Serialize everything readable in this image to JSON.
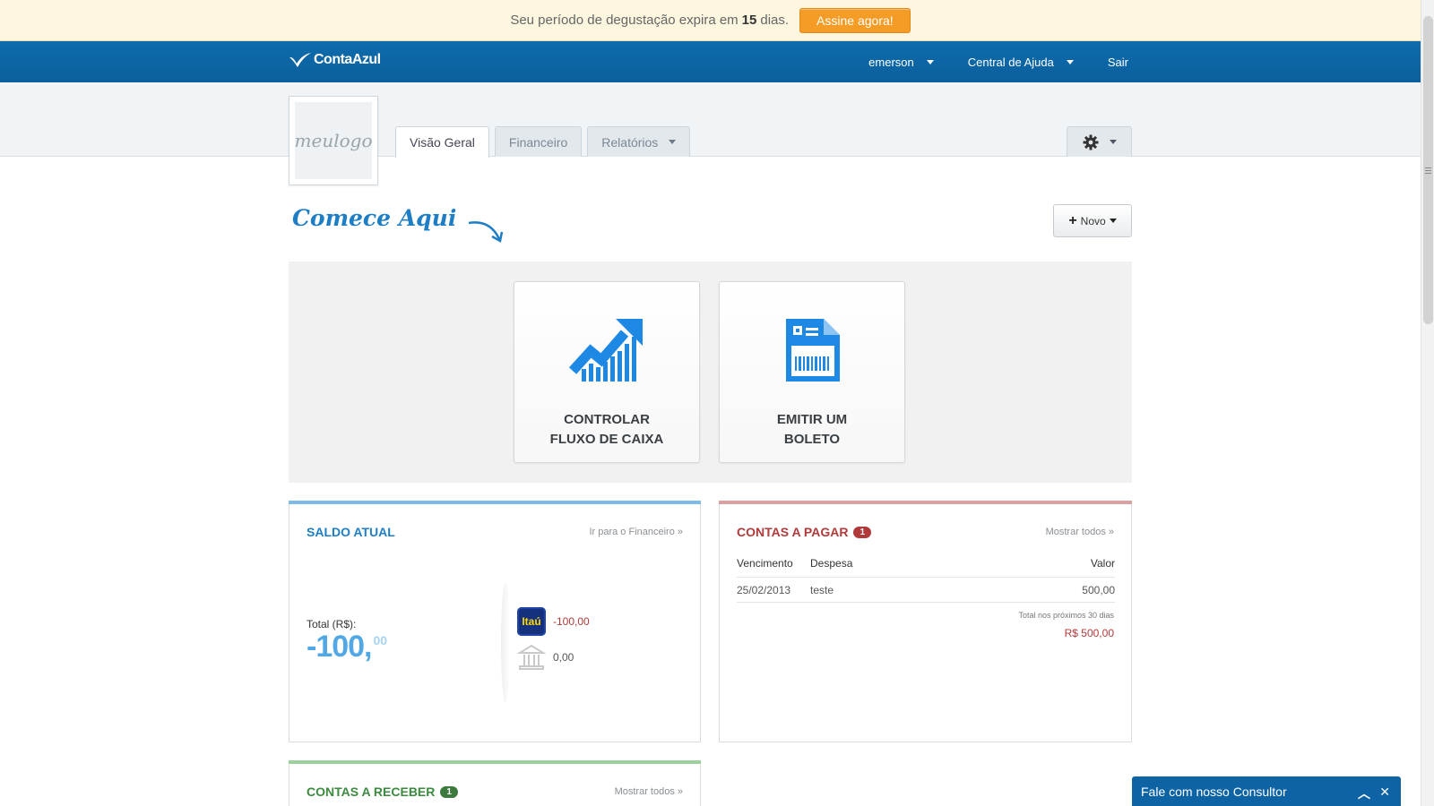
{
  "trial": {
    "text": "Seu período de degustação expira em",
    "days": "15",
    "suffix": "dias.",
    "cta": "Assine agora!"
  },
  "nav": {
    "brand": "ContaAzul",
    "user": "emerson",
    "help": "Central de Ajuda",
    "logout": "Sair"
  },
  "company_logo": "meulogo",
  "tabs": [
    "Visão Geral",
    "Financeiro",
    "Relatórios"
  ],
  "start": {
    "heading": "Comece Aqui",
    "new_button": "Novo"
  },
  "actions": [
    {
      "line1": "CONTROLAR",
      "line2": "FLUXO DE CAIXA",
      "icon": "chart-growth-icon"
    },
    {
      "line1": "EMITIR UM",
      "line2": "BOLETO",
      "icon": "boleto-document-icon"
    }
  ],
  "saldo": {
    "title": "SALDO ATUAL",
    "link": "Ir para o Financeiro »",
    "total_label": "Total (R$):",
    "total_integer": "-100,",
    "total_cents": "00",
    "accounts": [
      {
        "logo_text": "Itaú",
        "value": "-100,00"
      },
      {
        "logo_text": "",
        "value": "0,00"
      }
    ]
  },
  "pagar": {
    "title": "CONTAS A PAGAR",
    "count": "1",
    "link": "Mostrar todos »",
    "columns": [
      "Vencimento",
      "Despesa",
      "Valor"
    ],
    "rows": [
      {
        "date": "25/02/2013",
        "desc": "teste",
        "value": "500,00"
      }
    ],
    "total_note": "Total nos próximos 30 dias",
    "total_value": "R$ 500,00"
  },
  "receber": {
    "title": "CONTAS A RECEBER",
    "count": "1",
    "link": "Mostrar todos »"
  },
  "consultor": {
    "label": "Fale com nosso Consultor"
  },
  "colors": {
    "brand_blue": "#0e6cad",
    "saldo_blue": "#1d7ec6",
    "pagar_red": "#b03a3a",
    "receber_green": "#3c8a3f",
    "cta_orange": "#f49c25"
  }
}
